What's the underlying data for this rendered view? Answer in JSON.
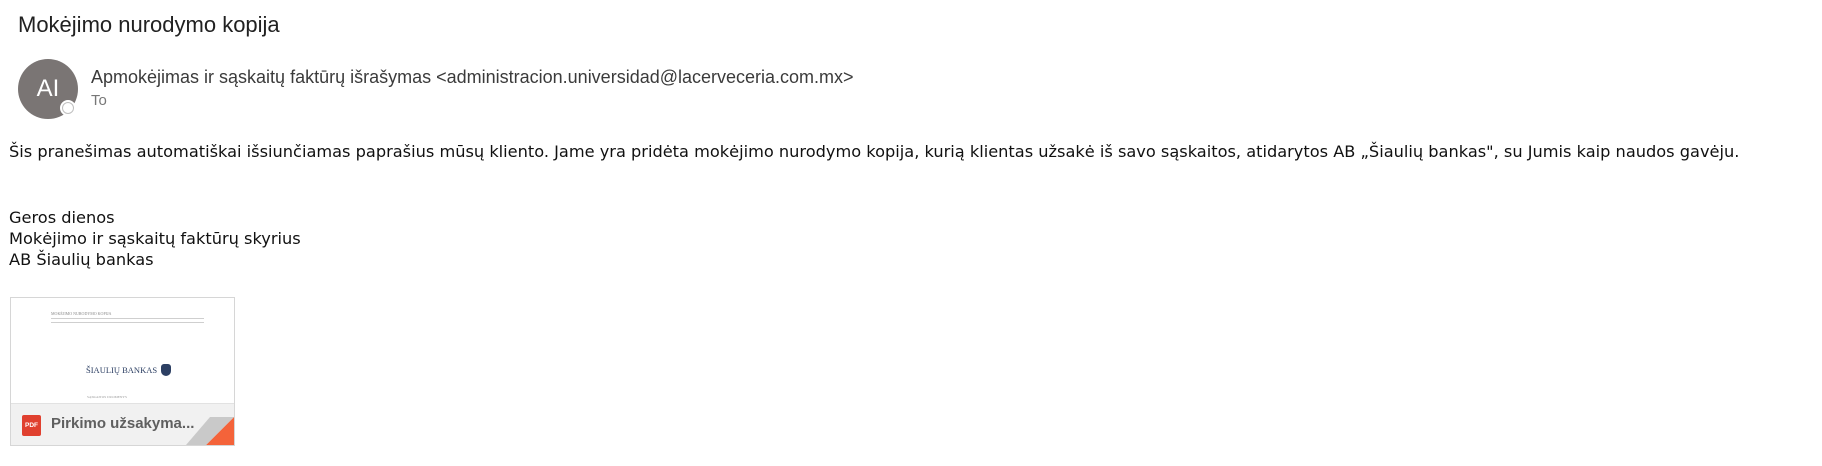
{
  "email": {
    "subject": "Mokėjimo nurodymo kopija",
    "sender": {
      "initials": "AI",
      "display": "Apmokėjimas ir sąskaitų faktūrų išrašymas <administracion.universidad@lacerveceria.com.mx>",
      "avatar_color": "#7a7574"
    },
    "to_label": "To",
    "body": {
      "paragraph": "Šis pranešimas automatiškai išsiunčiamas paprašius mūsų kliento. Jame yra pridėta mokėjimo nurodymo kopija, kurią klientas užsakė iš savo sąskaitos, atidarytos AB „Šiaulių bankas\", su Jumis kaip naudos gavėju.",
      "signature": [
        "Geros dienos",
        "Mokėjimo ir sąskaitų faktūrų skyrius",
        "AB Šiaulių bankas"
      ]
    },
    "attachment": {
      "file_name": "Pirkimo užsakyma...",
      "file_type_badge": "PDF",
      "icon": "pdf-file-icon",
      "preview": {
        "logo_text": "ŠIAULIŲ BANKAS",
        "header_text": "MOKĖJIMO NURODYMO KOPIJA",
        "footer_text": "SĄSKAITOS DUOMENYS"
      },
      "badge_color": "#e0402f",
      "corner_color": "#f4633a"
    }
  }
}
